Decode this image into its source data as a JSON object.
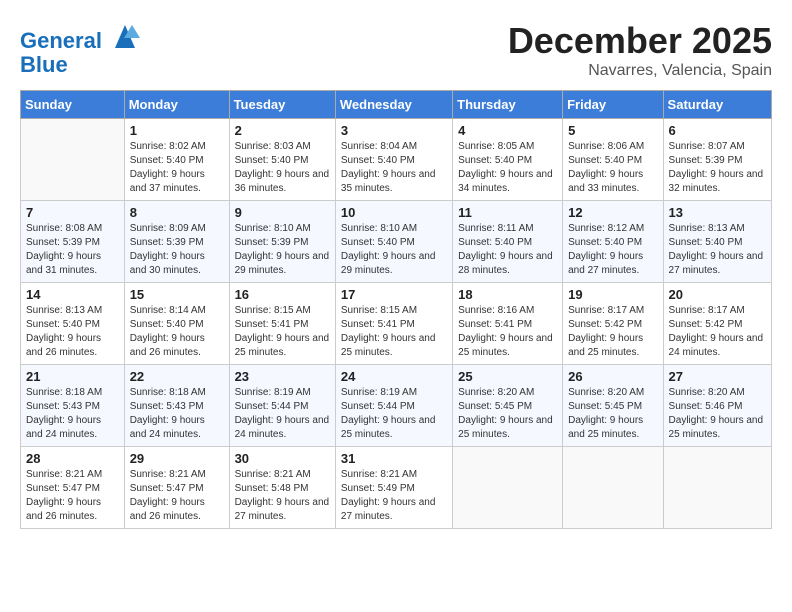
{
  "header": {
    "logo_line1": "General",
    "logo_line2": "Blue",
    "month": "December 2025",
    "location": "Navarres, Valencia, Spain"
  },
  "weekdays": [
    "Sunday",
    "Monday",
    "Tuesday",
    "Wednesday",
    "Thursday",
    "Friday",
    "Saturday"
  ],
  "weeks": [
    [
      {
        "day": "",
        "empty": true
      },
      {
        "day": "1",
        "sunrise": "Sunrise: 8:02 AM",
        "sunset": "Sunset: 5:40 PM",
        "daylight": "Daylight: 9 hours and 37 minutes."
      },
      {
        "day": "2",
        "sunrise": "Sunrise: 8:03 AM",
        "sunset": "Sunset: 5:40 PM",
        "daylight": "Daylight: 9 hours and 36 minutes."
      },
      {
        "day": "3",
        "sunrise": "Sunrise: 8:04 AM",
        "sunset": "Sunset: 5:40 PM",
        "daylight": "Daylight: 9 hours and 35 minutes."
      },
      {
        "day": "4",
        "sunrise": "Sunrise: 8:05 AM",
        "sunset": "Sunset: 5:40 PM",
        "daylight": "Daylight: 9 hours and 34 minutes."
      },
      {
        "day": "5",
        "sunrise": "Sunrise: 8:06 AM",
        "sunset": "Sunset: 5:40 PM",
        "daylight": "Daylight: 9 hours and 33 minutes."
      },
      {
        "day": "6",
        "sunrise": "Sunrise: 8:07 AM",
        "sunset": "Sunset: 5:39 PM",
        "daylight": "Daylight: 9 hours and 32 minutes."
      }
    ],
    [
      {
        "day": "7",
        "sunrise": "Sunrise: 8:08 AM",
        "sunset": "Sunset: 5:39 PM",
        "daylight": "Daylight: 9 hours and 31 minutes."
      },
      {
        "day": "8",
        "sunrise": "Sunrise: 8:09 AM",
        "sunset": "Sunset: 5:39 PM",
        "daylight": "Daylight: 9 hours and 30 minutes."
      },
      {
        "day": "9",
        "sunrise": "Sunrise: 8:10 AM",
        "sunset": "Sunset: 5:39 PM",
        "daylight": "Daylight: 9 hours and 29 minutes."
      },
      {
        "day": "10",
        "sunrise": "Sunrise: 8:10 AM",
        "sunset": "Sunset: 5:40 PM",
        "daylight": "Daylight: 9 hours and 29 minutes."
      },
      {
        "day": "11",
        "sunrise": "Sunrise: 8:11 AM",
        "sunset": "Sunset: 5:40 PM",
        "daylight": "Daylight: 9 hours and 28 minutes."
      },
      {
        "day": "12",
        "sunrise": "Sunrise: 8:12 AM",
        "sunset": "Sunset: 5:40 PM",
        "daylight": "Daylight: 9 hours and 27 minutes."
      },
      {
        "day": "13",
        "sunrise": "Sunrise: 8:13 AM",
        "sunset": "Sunset: 5:40 PM",
        "daylight": "Daylight: 9 hours and 27 minutes."
      }
    ],
    [
      {
        "day": "14",
        "sunrise": "Sunrise: 8:13 AM",
        "sunset": "Sunset: 5:40 PM",
        "daylight": "Daylight: 9 hours and 26 minutes."
      },
      {
        "day": "15",
        "sunrise": "Sunrise: 8:14 AM",
        "sunset": "Sunset: 5:40 PM",
        "daylight": "Daylight: 9 hours and 26 minutes."
      },
      {
        "day": "16",
        "sunrise": "Sunrise: 8:15 AM",
        "sunset": "Sunset: 5:41 PM",
        "daylight": "Daylight: 9 hours and 25 minutes."
      },
      {
        "day": "17",
        "sunrise": "Sunrise: 8:15 AM",
        "sunset": "Sunset: 5:41 PM",
        "daylight": "Daylight: 9 hours and 25 minutes."
      },
      {
        "day": "18",
        "sunrise": "Sunrise: 8:16 AM",
        "sunset": "Sunset: 5:41 PM",
        "daylight": "Daylight: 9 hours and 25 minutes."
      },
      {
        "day": "19",
        "sunrise": "Sunrise: 8:17 AM",
        "sunset": "Sunset: 5:42 PM",
        "daylight": "Daylight: 9 hours and 25 minutes."
      },
      {
        "day": "20",
        "sunrise": "Sunrise: 8:17 AM",
        "sunset": "Sunset: 5:42 PM",
        "daylight": "Daylight: 9 hours and 24 minutes."
      }
    ],
    [
      {
        "day": "21",
        "sunrise": "Sunrise: 8:18 AM",
        "sunset": "Sunset: 5:43 PM",
        "daylight": "Daylight: 9 hours and 24 minutes."
      },
      {
        "day": "22",
        "sunrise": "Sunrise: 8:18 AM",
        "sunset": "Sunset: 5:43 PM",
        "daylight": "Daylight: 9 hours and 24 minutes."
      },
      {
        "day": "23",
        "sunrise": "Sunrise: 8:19 AM",
        "sunset": "Sunset: 5:44 PM",
        "daylight": "Daylight: 9 hours and 24 minutes."
      },
      {
        "day": "24",
        "sunrise": "Sunrise: 8:19 AM",
        "sunset": "Sunset: 5:44 PM",
        "daylight": "Daylight: 9 hours and 25 minutes."
      },
      {
        "day": "25",
        "sunrise": "Sunrise: 8:20 AM",
        "sunset": "Sunset: 5:45 PM",
        "daylight": "Daylight: 9 hours and 25 minutes."
      },
      {
        "day": "26",
        "sunrise": "Sunrise: 8:20 AM",
        "sunset": "Sunset: 5:45 PM",
        "daylight": "Daylight: 9 hours and 25 minutes."
      },
      {
        "day": "27",
        "sunrise": "Sunrise: 8:20 AM",
        "sunset": "Sunset: 5:46 PM",
        "daylight": "Daylight: 9 hours and 25 minutes."
      }
    ],
    [
      {
        "day": "28",
        "sunrise": "Sunrise: 8:21 AM",
        "sunset": "Sunset: 5:47 PM",
        "daylight": "Daylight: 9 hours and 26 minutes."
      },
      {
        "day": "29",
        "sunrise": "Sunrise: 8:21 AM",
        "sunset": "Sunset: 5:47 PM",
        "daylight": "Daylight: 9 hours and 26 minutes."
      },
      {
        "day": "30",
        "sunrise": "Sunrise: 8:21 AM",
        "sunset": "Sunset: 5:48 PM",
        "daylight": "Daylight: 9 hours and 27 minutes."
      },
      {
        "day": "31",
        "sunrise": "Sunrise: 8:21 AM",
        "sunset": "Sunset: 5:49 PM",
        "daylight": "Daylight: 9 hours and 27 minutes."
      },
      {
        "day": "",
        "empty": true
      },
      {
        "day": "",
        "empty": true
      },
      {
        "day": "",
        "empty": true
      }
    ]
  ]
}
